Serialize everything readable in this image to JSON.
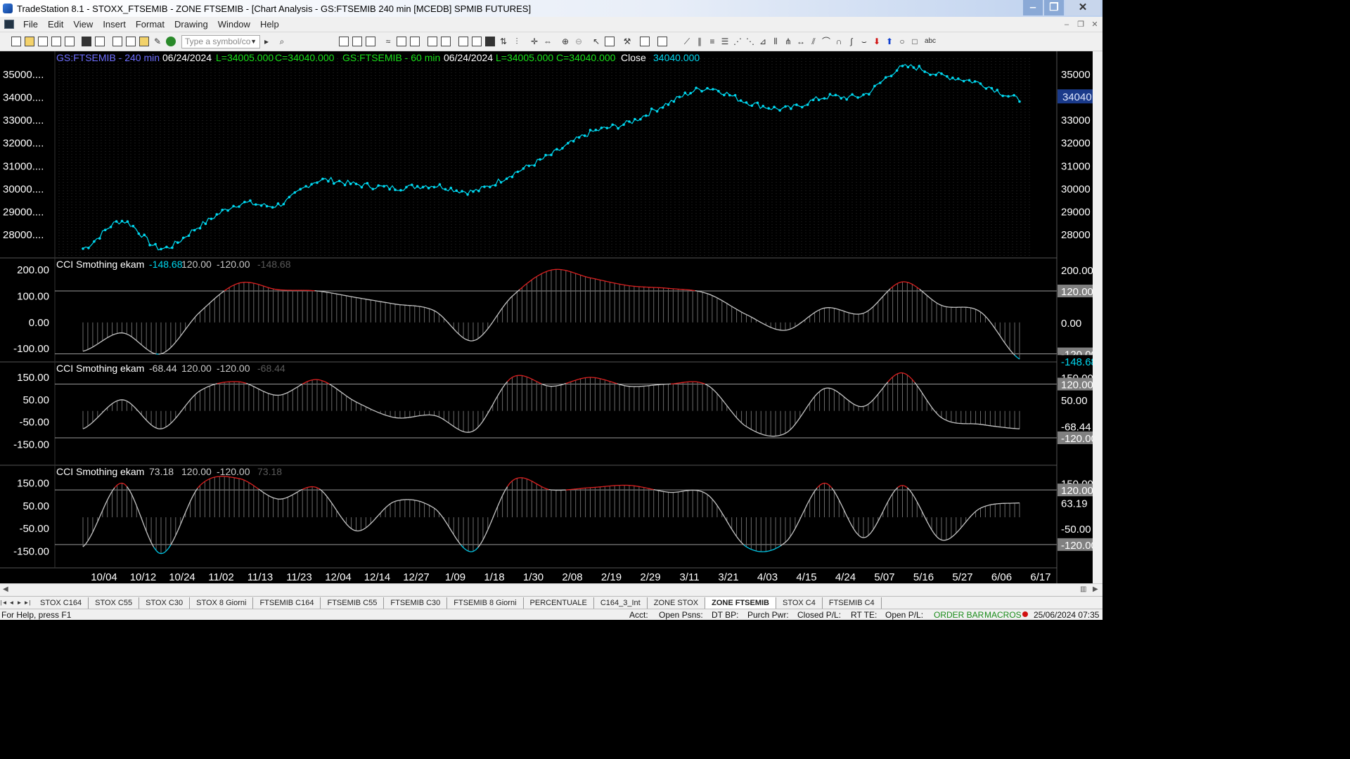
{
  "window": {
    "title": "TradeStation 8.1 - STOXX_FTSEMIB - ZONE FTSEMIB - [Chart Analysis - GS:FTSEMIB  240 min  [MCEDB] SPMIB FUTURES]",
    "controls": [
      "‒",
      "❐",
      "✕"
    ]
  },
  "menu": {
    "items": [
      "File",
      "Edit",
      "View",
      "Insert",
      "Format",
      "Drawing",
      "Window",
      "Help"
    ],
    "mdi_controls": [
      "–",
      "❐",
      "✕"
    ]
  },
  "toolbar": {
    "symbol_placeholder": "Type a symbol/co",
    "text_tool": "abc"
  },
  "chart": {
    "header": {
      "symbol1": "GS:FTSEMIB - 240 min",
      "date1": "06/24/2024",
      "low1": "L=34005.000",
      "close1": "C=34040.000",
      "symbol2": "GS:FTSEMIB - 60 min",
      "date2": "06/24/2024",
      "low2": "L=34005.000",
      "close2": "C=34040.000",
      "close_label": "Close",
      "close_value": "34040.000"
    },
    "last_price_label": "34040",
    "colors": {
      "price": "#00d8f0",
      "cci_above": "#e02020",
      "cci_below": "#00c8e8",
      "cci_line": "#c8c8c8",
      "grid": "#3a3a3a",
      "text": "#ffffff",
      "header_blue": "#6e6eff",
      "header_green": "#18e018"
    },
    "x_labels": [
      "10/04",
      "10/12",
      "10/24",
      "11/02",
      "11/13",
      "11/23",
      "12/04",
      "12/14",
      "12/27",
      "1/09",
      "1/18",
      "1/30",
      "2/08",
      "2/19",
      "2/29",
      "3/11",
      "3/21",
      "4/03",
      "4/15",
      "4/24",
      "5/07",
      "5/16",
      "5/27",
      "6/06",
      "6/17"
    ],
    "price_panel": {
      "y_labels": [
        "35000....",
        "34000....",
        "33000....",
        "32000....",
        "31000....",
        "30000....",
        "29000....",
        "28000...."
      ],
      "y_labels_right": [
        "35000",
        "34000",
        "33000",
        "32000",
        "31000",
        "30000",
        "29000",
        "28000"
      ],
      "y_min": 27300,
      "y_max": 35700
    },
    "indicators": [
      {
        "title": "CCI Smothing ekam",
        "value": "-148.68",
        "upper": "120.00",
        "lower": "-120.00",
        "dim_value": "-148.68",
        "y_labels": [
          "200.00",
          "100.00",
          "0.00",
          "-100.00"
        ],
        "right_labels": [
          "200.00",
          "120.00",
          "0.00",
          "-120.00",
          "-148.68"
        ],
        "ymin": -140,
        "ymax": 230
      },
      {
        "title": "CCI Smothing ekam",
        "value": "-68.44",
        "upper": "120.00",
        "lower": "-120.00",
        "dim_value": "-68.44",
        "y_labels": [
          "150.00",
          "50.00",
          "-50.00",
          "-150.00"
        ],
        "right_labels": [
          "150.00",
          "120.00",
          "50.00",
          "-68.44",
          "-120.00"
        ],
        "ymin": -230,
        "ymax": 200
      },
      {
        "title": "CCI Smothing ekam",
        "value": "73.18",
        "upper": "120.00",
        "lower": "-120.00",
        "dim_value": "73.18",
        "y_labels": [
          "150.00",
          "50.00",
          "-50.00",
          "-150.00"
        ],
        "right_labels": [
          "150.00",
          "120.00",
          "63.19",
          "-50.00",
          "-120.00"
        ],
        "ymin": -210,
        "ymax": 210
      }
    ]
  },
  "chart_data": [
    {
      "type": "line",
      "title": "GS:FTSEMIB - 240 min",
      "x": [
        "10/04",
        "10/12",
        "10/24",
        "11/02",
        "11/13",
        "11/23",
        "12/04",
        "12/14",
        "12/27",
        "1/09",
        "1/18",
        "1/30",
        "2/08",
        "2/19",
        "2/29",
        "3/11",
        "3/21",
        "4/03",
        "4/15",
        "4/24",
        "5/07",
        "5/16",
        "5/27",
        "6/06",
        "6/17"
      ],
      "series": [
        {
          "name": "Close",
          "values": [
            27400,
            28600,
            27400,
            28400,
            29350,
            29300,
            30350,
            30200,
            30050,
            30150,
            29900,
            30650,
            31500,
            32450,
            32900,
            33750,
            34400,
            33800,
            33500,
            34000,
            34100,
            35300,
            34950,
            34600,
            33900
          ]
        }
      ],
      "ylim": [
        27300,
        35700
      ],
      "ylabel": "",
      "xlabel": ""
    },
    {
      "type": "area",
      "title": "CCI Smothing ekam",
      "x": [
        "10/04",
        "10/12",
        "10/24",
        "11/02",
        "11/13",
        "11/23",
        "12/04",
        "12/14",
        "12/27",
        "1/09",
        "1/18",
        "1/30",
        "2/08",
        "2/19",
        "2/29",
        "3/11",
        "3/21",
        "4/03",
        "4/15",
        "4/24",
        "5/07",
        "5/16",
        "5/27",
        "6/06",
        "6/17"
      ],
      "series": [
        {
          "name": "CCI Smothing ekam",
          "values": [
            -110,
            -40,
            -120,
            40,
            150,
            125,
            120,
            95,
            70,
            45,
            -70,
            100,
            200,
            170,
            140,
            130,
            110,
            30,
            -30,
            55,
            35,
            155,
            65,
            40,
            -140
          ]
        }
      ],
      "reference_lines": [
        120,
        -120
      ],
      "ylim": [
        -140,
        230
      ]
    },
    {
      "type": "area",
      "title": "CCI Smothing ekam",
      "x": [
        "10/04",
        "10/12",
        "10/24",
        "11/02",
        "11/13",
        "11/23",
        "12/04",
        "12/14",
        "12/27",
        "1/09",
        "1/18",
        "1/30",
        "2/08",
        "2/19",
        "2/29",
        "3/11",
        "3/21",
        "4/03",
        "4/15",
        "4/24",
        "5/07",
        "5/16",
        "5/27",
        "6/06",
        "6/17"
      ],
      "series": [
        {
          "name": "CCI Smothing ekam",
          "values": [
            -80,
            50,
            -80,
            90,
            130,
            70,
            140,
            40,
            -30,
            -20,
            -90,
            150,
            110,
            150,
            110,
            120,
            115,
            -70,
            -100,
            100,
            20,
            170,
            -30,
            -60,
            -80
          ]
        }
      ],
      "reference_lines": [
        120,
        -120
      ],
      "ylim": [
        -230,
        200
      ]
    },
    {
      "type": "area",
      "title": "CCI Smothing ekam",
      "x": [
        "10/04",
        "10/12",
        "10/24",
        "11/02",
        "11/13",
        "11/23",
        "12/04",
        "12/14",
        "12/27",
        "1/09",
        "1/18",
        "1/30",
        "2/08",
        "2/19",
        "2/29",
        "3/11",
        "3/21",
        "4/03",
        "4/15",
        "4/24",
        "5/07",
        "5/16",
        "5/27",
        "6/06",
        "6/17"
      ],
      "series": [
        {
          "name": "CCI Smothing ekam",
          "values": [
            -130,
            150,
            -160,
            140,
            170,
            80,
            130,
            -60,
            70,
            40,
            -150,
            160,
            120,
            130,
            140,
            110,
            100,
            -130,
            -110,
            150,
            -90,
            140,
            -100,
            40,
            63
          ]
        }
      ],
      "reference_lines": [
        120,
        -120
      ],
      "ylim": [
        -210,
        210
      ]
    }
  ],
  "tabs": {
    "nav": [
      "|◄",
      "◄",
      "►",
      "►|"
    ],
    "items": [
      "STOX C164",
      "STOX C55",
      "STOX  C30",
      "STOX  8 Giorni",
      "FTSEMIB C164",
      "FTSEMIB C55",
      "FTSEMIB C30",
      "FTSEMIB  8 Giorni",
      "PERCENTUALE",
      "C164_3_Int",
      "ZONE STOX",
      "ZONE FTSEMIB",
      "STOX  C4",
      "FTSEMIB C4"
    ],
    "active": "ZONE FTSEMIB"
  },
  "status": {
    "help": "For Help, press F1",
    "acct": "Acct:",
    "open_psns": "Open Psns:",
    "dt_bp": "DT BP:",
    "purch_pwr": "Purch Pwr:",
    "closed_pl": "Closed P/L:",
    "rt_te": "RT TE:",
    "open_pl": "Open P/L:",
    "order_bar": "ORDER BAR",
    "macros": "MACROS",
    "datetime": "25/06/2024 07:35"
  }
}
